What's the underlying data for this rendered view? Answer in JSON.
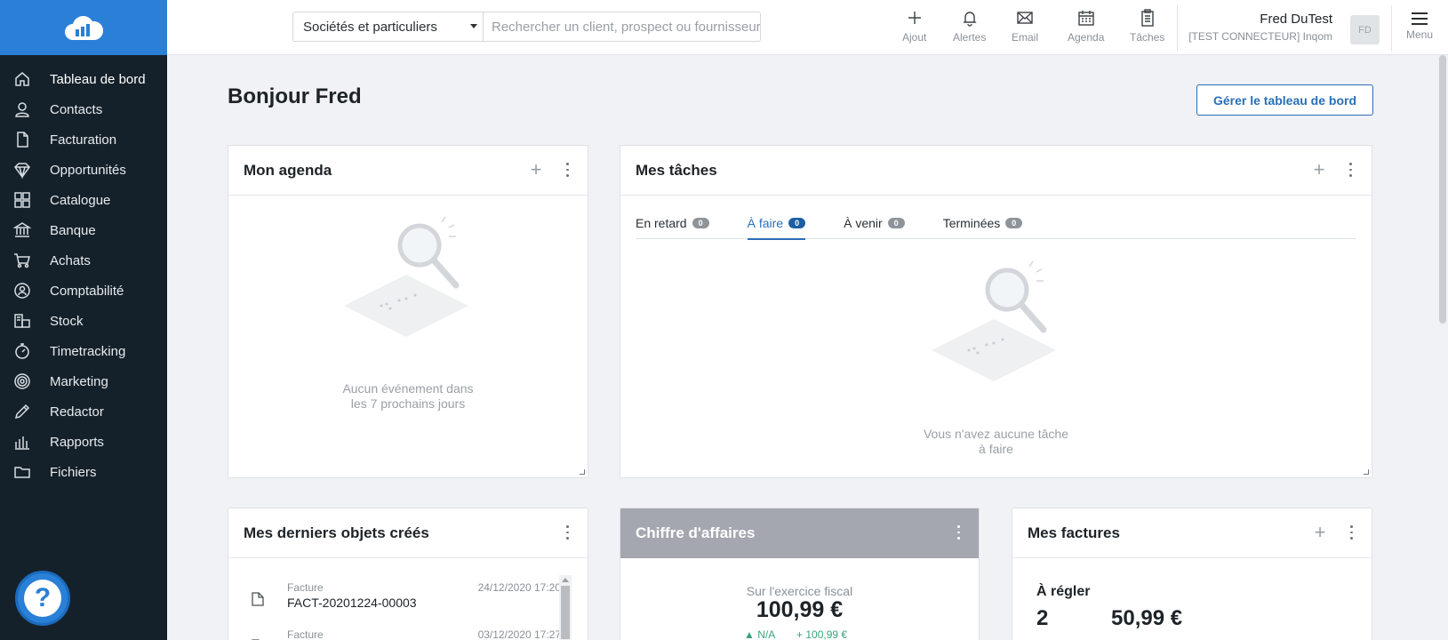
{
  "sidebar": {
    "items": [
      {
        "label": "Tableau de bord",
        "icon": "home-icon"
      },
      {
        "label": "Contacts",
        "icon": "user-icon"
      },
      {
        "label": "Facturation",
        "icon": "document-icon"
      },
      {
        "label": "Opportunités",
        "icon": "diamond-icon"
      },
      {
        "label": "Catalogue",
        "icon": "grid-icon"
      },
      {
        "label": "Banque",
        "icon": "bank-icon"
      },
      {
        "label": "Achats",
        "icon": "cart-icon"
      },
      {
        "label": "Comptabilité",
        "icon": "accounting-icon"
      },
      {
        "label": "Stock",
        "icon": "stock-icon"
      },
      {
        "label": "Timetracking",
        "icon": "stopwatch-icon"
      },
      {
        "label": "Marketing",
        "icon": "target-icon"
      },
      {
        "label": "Redactor",
        "icon": "pencil-icon"
      },
      {
        "label": "Rapports",
        "icon": "bar-chart-icon"
      },
      {
        "label": "Fichiers",
        "icon": "folder-icon"
      }
    ],
    "help_label": "?"
  },
  "topbar": {
    "company_select": "Sociétés et particuliers",
    "search_placeholder": "Rechercher un client, prospect ou fournisseur",
    "actions": {
      "add": "Ajout",
      "alerts": "Alertes",
      "email": "Email",
      "agenda": "Agenda",
      "tasks": "Tâches"
    },
    "user_name": "Fred DuTest",
    "user_org": "[TEST CONNECTEUR] Inqom",
    "avatar_initials": "FD",
    "menu_label": "Menu"
  },
  "main": {
    "greeting": "Bonjour Fred",
    "manage_button": "Gérer le tableau de bord",
    "agenda": {
      "title": "Mon agenda",
      "empty_line1": "Aucun événement dans",
      "empty_line2": "les 7 prochains jours"
    },
    "tasks": {
      "title": "Mes tâches",
      "tabs": [
        {
          "label": "En retard",
          "count": "0"
        },
        {
          "label": "À faire",
          "count": "0"
        },
        {
          "label": "À venir",
          "count": "0"
        },
        {
          "label": "Terminées",
          "count": "0"
        }
      ],
      "empty_line1": "Vous n'avez aucune tâche",
      "empty_line2": "à faire"
    },
    "recent": {
      "title": "Mes derniers objets créés",
      "items": [
        {
          "type": "Facture",
          "ref": "FACT-20201224-00003",
          "date": "24/12/2020 17:20"
        },
        {
          "type": "Facture",
          "ref": "",
          "date": "03/12/2020 17:27"
        }
      ]
    },
    "revenue": {
      "title": "Chiffre d'affaires",
      "caption": "Sur l'exercice fiscal",
      "amount": "100,99 €",
      "change_na": "▲ N/A",
      "change_delta": "+ 100,99 €"
    },
    "invoices": {
      "title": "Mes factures",
      "section": "À régler",
      "count": "2",
      "amount": "50,99 €"
    }
  },
  "colors": {
    "brand_blue": "#2a7fd6",
    "sidebar_bg": "#15212a",
    "link_blue": "#2a6fb7",
    "revenue_header": "#a4a7b0",
    "positive_green": "#3aa57a"
  }
}
